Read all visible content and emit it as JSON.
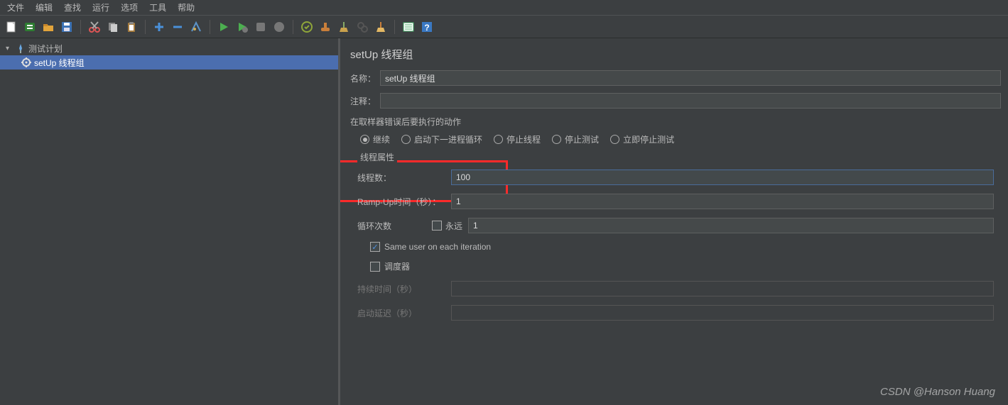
{
  "menu": {
    "items": [
      "文件",
      "编辑",
      "查找",
      "运行",
      "选项",
      "工具",
      "帮助"
    ]
  },
  "tree": {
    "root": "测试计划",
    "child": "setUp 线程组"
  },
  "form": {
    "title": "setUp 线程组",
    "name_label": "名称：",
    "name_value": "setUp 线程组",
    "comment_label": "注释：",
    "comment_value": "",
    "error_action_label": "在取样器错误后要执行的动作",
    "actions": {
      "continue": "继续",
      "next_loop": "启动下一进程循环",
      "stop_thread": "停止线程",
      "stop_test": "停止测试",
      "stop_now": "立即停止测试"
    },
    "thread_props_legend": "线程属性",
    "threads_label": "线程数：",
    "threads_value": "100",
    "rampup_label": "Ramp-Up时间（秒）：",
    "rampup_value": "1",
    "loop_label": "循环次数",
    "loop_forever": "永远",
    "loop_value": "1",
    "same_user": "Same user on each iteration",
    "scheduler": "调度器",
    "duration_label": "持续时间（秒）",
    "delay_label": "启动延迟（秒）"
  },
  "watermark": "CSDN @Hanson Huang"
}
